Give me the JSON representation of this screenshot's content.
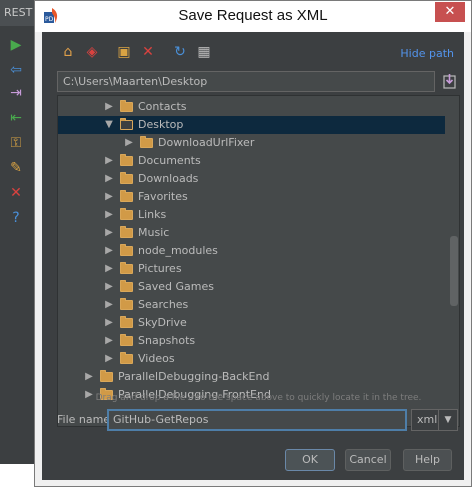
{
  "ide": {
    "tab_label": "REST",
    "icons": [
      {
        "name": "run-icon",
        "glyph": "▶",
        "color": "#49a94d"
      },
      {
        "name": "back-arrow-icon",
        "glyph": "⇦",
        "color": "#4a90d9"
      },
      {
        "name": "export-icon",
        "glyph": "⇥",
        "color": "#c79bd9"
      },
      {
        "name": "import-icon",
        "glyph": "⇤",
        "color": "#49a94d"
      },
      {
        "name": "key-icon",
        "glyph": "⚿",
        "color": "#d9a343"
      },
      {
        "name": "wrench-icon",
        "glyph": "✎",
        "color": "#d9a343"
      },
      {
        "name": "close-icon",
        "glyph": "✕",
        "color": "#d9423f"
      },
      {
        "name": "help-icon",
        "glyph": "?",
        "color": "#4a90d9"
      }
    ]
  },
  "dialog": {
    "title": "Save Request as XML",
    "close_glyph": "✕",
    "hide_path_label": "Hide path",
    "path_value": "C:\\Users\\Maarten\\Desktop",
    "hint": "Drag and drop a file into the space above to quickly locate it in the tree.",
    "file_name_label": "File name:",
    "file_name_value": "GitHub-GetRepos",
    "extension": "xml",
    "buttons": {
      "ok": "OK",
      "cancel": "Cancel",
      "help": "Help"
    }
  },
  "toolbar": {
    "icons": [
      {
        "name": "home-icon",
        "glyph": "⌂",
        "color": "#e0a04a"
      },
      {
        "name": "project-icon",
        "glyph": "◈",
        "color": "#d9423f"
      },
      {
        "name": "new-folder-icon",
        "glyph": "▣",
        "color": "#d9a343"
      },
      {
        "name": "delete-icon",
        "glyph": "✕",
        "color": "#d9423f"
      },
      {
        "name": "refresh-icon",
        "glyph": "↻",
        "color": "#4a90d9"
      },
      {
        "name": "show-hidden-icon",
        "glyph": "▦",
        "color": "#bbbbbb"
      }
    ]
  },
  "tree": {
    "rows": [
      {
        "label": "Contacts",
        "level": 1,
        "expanded": false,
        "selected": false
      },
      {
        "label": "Desktop",
        "level": 1,
        "expanded": true,
        "selected": true
      },
      {
        "label": "DownloadUrlFixer",
        "level": 2,
        "expanded": false,
        "selected": false
      },
      {
        "label": "Documents",
        "level": 1,
        "expanded": false,
        "selected": false
      },
      {
        "label": "Downloads",
        "level": 1,
        "expanded": false,
        "selected": false
      },
      {
        "label": "Favorites",
        "level": 1,
        "expanded": false,
        "selected": false
      },
      {
        "label": "Links",
        "level": 1,
        "expanded": false,
        "selected": false
      },
      {
        "label": "Music",
        "level": 1,
        "expanded": false,
        "selected": false
      },
      {
        "label": "node_modules",
        "level": 1,
        "expanded": false,
        "selected": false
      },
      {
        "label": "Pictures",
        "level": 1,
        "expanded": false,
        "selected": false
      },
      {
        "label": "Saved Games",
        "level": 1,
        "expanded": false,
        "selected": false
      },
      {
        "label": "Searches",
        "level": 1,
        "expanded": false,
        "selected": false
      },
      {
        "label": "SkyDrive",
        "level": 1,
        "expanded": false,
        "selected": false
      },
      {
        "label": "Snapshots",
        "level": 1,
        "expanded": false,
        "selected": false
      },
      {
        "label": "Videos",
        "level": 1,
        "expanded": false,
        "selected": false
      },
      {
        "label": "ParallelDebugging-BackEnd",
        "level": 0,
        "expanded": false,
        "selected": false
      },
      {
        "label": "ParallelDebugging-FrontEnd",
        "level": 0,
        "expanded": false,
        "selected": false
      }
    ]
  }
}
